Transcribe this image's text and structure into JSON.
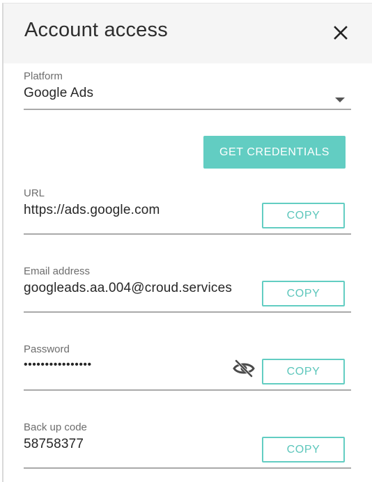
{
  "panel": {
    "title": "Account access",
    "close_icon": "close-icon"
  },
  "platform": {
    "label": "Platform",
    "selected": "Google Ads",
    "arrow_icon": "caret-down-icon"
  },
  "actions": {
    "get_credentials_label": "GET CREDENTIALS"
  },
  "fields": {
    "url": {
      "label": "URL",
      "value": "https://ads.google.com",
      "copy_label": "COPY"
    },
    "email": {
      "label": "Email address",
      "value": "googleads.aa.004@croud.services",
      "copy_label": "COPY"
    },
    "password": {
      "label": "Password",
      "value": "••••••••••••••••",
      "visibility_icon": "eye-off-icon",
      "copy_label": "COPY"
    },
    "backup_code": {
      "label": "Back up code",
      "value": "58758377",
      "copy_label": "COPY"
    }
  },
  "colors": {
    "accent": "#62cdc2",
    "header_bg": "#f5f5f5",
    "underline": "#a9a9a9",
    "label": "#6d6d6d",
    "text": "#262626"
  }
}
